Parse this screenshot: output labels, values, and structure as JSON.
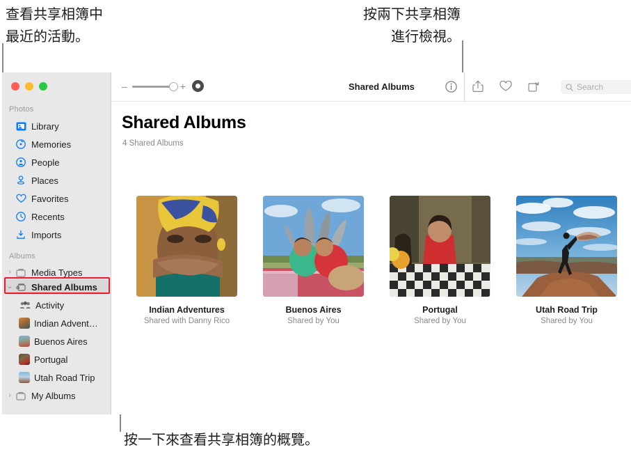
{
  "annotations": {
    "top_left": "查看共享相簿中\n最近的活動。",
    "top_right": "按兩下共享相簿\n進行檢視。",
    "bottom": "按一下來查看共享相簿的概覽。"
  },
  "window": {
    "traffic_lights": {
      "close": "close-button",
      "minimize": "minimize-button",
      "zoom": "zoom-button"
    }
  },
  "toolbar": {
    "zoom_minus": "–",
    "zoom_plus": "+",
    "title": "Shared Albums",
    "info_icon": "info-icon",
    "share_icon": "share-icon",
    "favorite_icon": "heart-icon",
    "rotate_icon": "rotate-icon",
    "search_icon": "search-icon",
    "search_placeholder": "Search",
    "search_value": ""
  },
  "sidebar": {
    "sections": [
      {
        "label": "Photos",
        "items": [
          {
            "label": "Library",
            "icon": "library-icon"
          },
          {
            "label": "Memories",
            "icon": "memories-icon"
          },
          {
            "label": "People",
            "icon": "people-icon"
          },
          {
            "label": "Places",
            "icon": "places-icon"
          },
          {
            "label": "Favorites",
            "icon": "heart-icon"
          },
          {
            "label": "Recents",
            "icon": "clock-icon"
          },
          {
            "label": "Imports",
            "icon": "import-icon"
          }
        ]
      },
      {
        "label": "Albums",
        "items": [
          {
            "label": "Media Types",
            "icon": "folder-icon",
            "twisty": "›"
          },
          {
            "label": "Shared Albums",
            "icon": "shared-album-icon",
            "twisty": "⌄",
            "selected": true,
            "highlighted": true
          },
          {
            "label": "Activity",
            "icon": "activity-icon",
            "indent": true
          },
          {
            "label": "Indian Advent…",
            "icon": "album-thumb-indian",
            "indent": true
          },
          {
            "label": "Buenos Aires",
            "icon": "album-thumb-buenos",
            "indent": true
          },
          {
            "label": "Portugal",
            "icon": "album-thumb-portugal",
            "indent": true
          },
          {
            "label": "Utah Road Trip",
            "icon": "album-thumb-utah",
            "indent": true
          },
          {
            "label": "My Albums",
            "icon": "folder-icon",
            "twisty": "›"
          }
        ]
      }
    ]
  },
  "main": {
    "title": "Shared Albums",
    "subtitle": "4 Shared Albums",
    "albums": [
      {
        "name": "Indian Adventures",
        "shared": "Shared with Danny Rico",
        "thumb": "portrait-headscarf"
      },
      {
        "name": "Buenos Aires",
        "shared": "Shared by You",
        "thumb": "kids-picnic-sculpture"
      },
      {
        "name": "Portugal",
        "shared": "Shared by You",
        "thumb": "woman-red-shirt-table"
      },
      {
        "name": "Utah Road Trip",
        "shared": "Shared by You",
        "thumb": "desert-jumping-silhouette"
      }
    ]
  },
  "colors": {
    "accent": "#0a7cff",
    "highlight": "#ee1b24",
    "sidebar_bg": "#e8e8e8",
    "leader": "#8a8a8a"
  }
}
